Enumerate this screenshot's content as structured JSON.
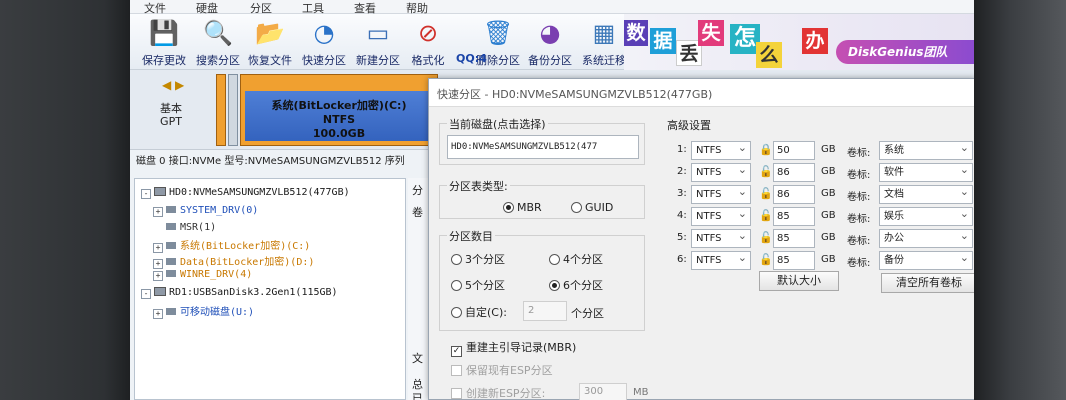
{
  "menu": [
    "文件",
    "硬盘",
    "分区",
    "工具",
    "查看",
    "帮助"
  ],
  "toolbar": [
    {
      "label": "保存更改",
      "icon": "save-icon",
      "color": "#3a7bd5"
    },
    {
      "label": "搜索分区",
      "icon": "search-partition-icon",
      "color": "#c2362c"
    },
    {
      "label": "恢复文件",
      "icon": "recover-file-icon",
      "color": "#2f8a2f"
    },
    {
      "label": "快速分区",
      "icon": "quick-partition-icon",
      "color": "#2a72c8"
    },
    {
      "label": "新建分区",
      "icon": "new-partition-icon",
      "color": "#3b6fb6"
    },
    {
      "label": "格式化",
      "icon": "format-icon",
      "color": "#d0302a"
    },
    {
      "label": "删除分区",
      "icon": "delete-partition-icon",
      "color": "#2d7fd0"
    },
    {
      "label": "备份分区",
      "icon": "backup-partition-icon",
      "color": "#7a3fb0"
    },
    {
      "label": "系统迁移",
      "icon": "system-migrate-icon",
      "color": "#3c78b8"
    }
  ],
  "banner": {
    "chars": [
      "数",
      "据",
      "丢",
      "失",
      "怎",
      "么",
      "办"
    ],
    "brand": "DiskGenius团队",
    "qq": "QQ:4"
  },
  "diskarea": {
    "basic": "基本",
    "gpt": "GPT",
    "partition_name": "系统(BitLocker加密)(C:)",
    "partition_fs": "NTFS",
    "partition_size": "100.0GB",
    "info": "磁盘 0 接口:NVMe  型号:NVMeSAMSUNGMZVLB512  序列"
  },
  "tree": [
    {
      "text": "HD0:NVMeSAMSUNGMZVLB512(477GB)",
      "type": "disk",
      "expand": "-",
      "color": "#1a1a1a",
      "level": 0
    },
    {
      "text": "SYSTEM_DRV(0)",
      "type": "part",
      "expand": "+",
      "color": "#1f4fb8",
      "level": 1
    },
    {
      "text": "MSR(1)",
      "type": "part",
      "expand": "",
      "color": "#333333",
      "level": 1
    },
    {
      "text": "系统(BitLocker加密)(C:)",
      "type": "part",
      "expand": "+",
      "color": "#c87800",
      "level": 1
    },
    {
      "text": "Data(BitLocker加密)(D:)",
      "type": "part",
      "expand": "+",
      "color": "#c87800",
      "level": 1
    },
    {
      "text": "WINRE_DRV(4)",
      "type": "part",
      "expand": "+",
      "color": "#c87800",
      "level": 1
    },
    {
      "text": "RD1:USBSanDisk3.2Gen1(115GB)",
      "type": "disk",
      "expand": "-",
      "color": "#1a1a1a",
      "level": 0
    },
    {
      "text": "可移动磁盘(U:)",
      "type": "part",
      "expand": "+",
      "color": "#1f4fb8",
      "level": 1
    }
  ],
  "rightpane": {
    "tab_text": [
      "分",
      "卷",
      "文",
      "总",
      "已"
    ]
  },
  "dialog": {
    "title": "快速分区 - HD0:NVMeSAMSUNGMZVLB512(477GB)",
    "current_disk_label": "当前磁盘(点击选择)",
    "current_disk_value": "HD0:NVMeSAMSUNGMZVLB512(477",
    "table_type_label": "分区表类型:",
    "mbr": "MBR",
    "guid": "GUID",
    "count_label": "分区数目",
    "count_options": [
      "3个分区",
      "4个分区",
      "5个分区",
      "6个分区"
    ],
    "custom_label": "自定(C):",
    "custom_value": "2",
    "custom_unit": "个分区",
    "rebuild_mbr": "重建主引导记录(MBR)",
    "keep_esp": "保留现有ESP分区",
    "create_esp": "创建新ESP分区:",
    "esp_size": "300",
    "esp_unit": "MB",
    "advanced_title": "高级设置",
    "partitions": [
      {
        "num": "1:",
        "fs": "NTFS",
        "size": "50",
        "unit": "GB",
        "label_prefix": "卷标:",
        "label": "系统"
      },
      {
        "num": "2:",
        "fs": "NTFS",
        "size": "86",
        "unit": "GB",
        "label_prefix": "卷标:",
        "label": "软件"
      },
      {
        "num": "3:",
        "fs": "NTFS",
        "size": "86",
        "unit": "GB",
        "label_prefix": "卷标:",
        "label": "文档"
      },
      {
        "num": "4:",
        "fs": "NTFS",
        "size": "85",
        "unit": "GB",
        "label_prefix": "卷标:",
        "label": "娱乐"
      },
      {
        "num": "5:",
        "fs": "NTFS",
        "size": "85",
        "unit": "GB",
        "label_prefix": "卷标:",
        "label": "办公"
      },
      {
        "num": "6:",
        "fs": "NTFS",
        "size": "85",
        "unit": "GB",
        "label_prefix": "卷标:",
        "label": "备份"
      }
    ],
    "default_size_button": "默认大小",
    "clear_labels_button": "清空所有卷标"
  }
}
